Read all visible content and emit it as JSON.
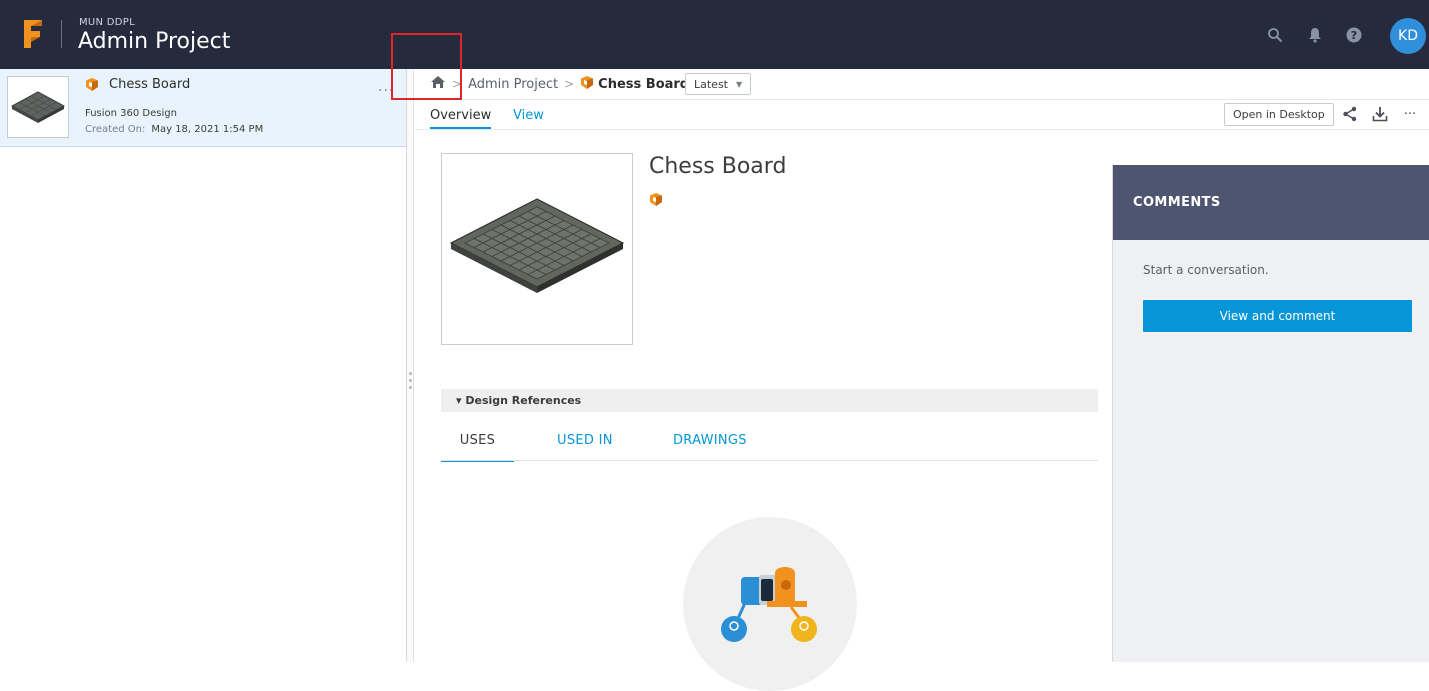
{
  "header": {
    "hub_name": "MUN DDPL",
    "project_title": "Admin Project",
    "avatar_initials": "KD",
    "icons": [
      "search-icon",
      "bell-icon",
      "help-icon"
    ]
  },
  "left_panel": {
    "item": {
      "name": "Chess Board",
      "type": "Fusion 360 Design",
      "created_label": "Created On:",
      "created_value": "May 18, 2021 1:54 PM",
      "menu": "..."
    }
  },
  "breadcrumb": {
    "home_icon": "home-icon",
    "project": "Admin Project",
    "current": "Chess Board",
    "version": "Latest"
  },
  "tabs": [
    {
      "label": "Overview",
      "active": true
    },
    {
      "label": "View",
      "active": false
    }
  ],
  "toolbar": {
    "open_desktop": "Open in Desktop",
    "icons": [
      "share-icon",
      "download-icon",
      "more-icon"
    ],
    "more": "···"
  },
  "design": {
    "title": "Chess Board"
  },
  "references": {
    "header": "▾ Design References",
    "tabs": [
      "USES",
      "USED IN",
      "DRAWINGS"
    ]
  },
  "comments": {
    "title": "COMMENTS",
    "prompt": "Start a conversation.",
    "button": "View and comment"
  },
  "colors": {
    "topbar": "#252a3d",
    "accent": "#0696d7",
    "comments_header": "#4e5570",
    "highlight": "#e0242b",
    "fusion_orange": "#f0921d"
  }
}
